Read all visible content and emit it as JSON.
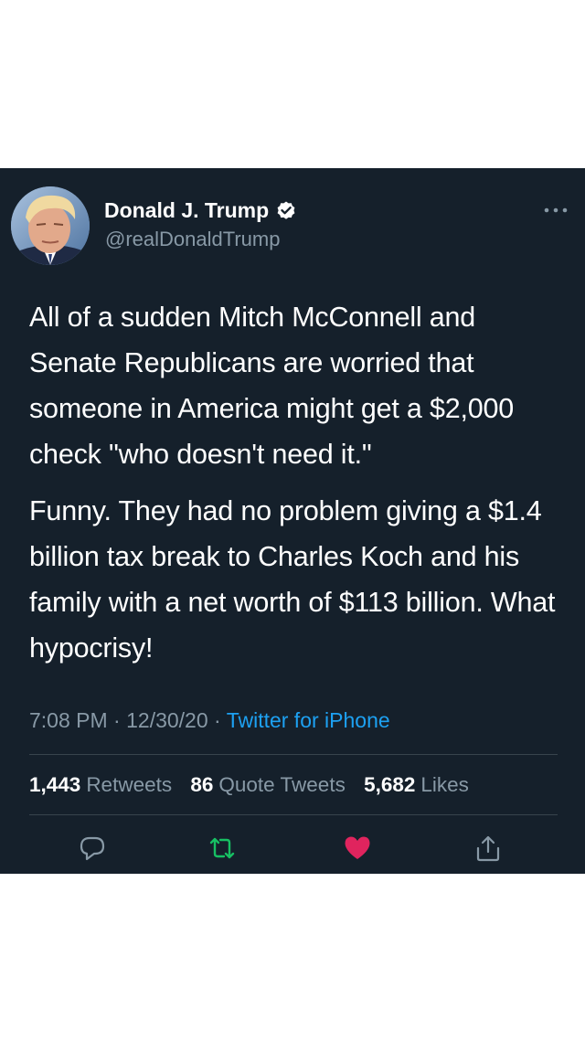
{
  "user": {
    "name": "Donald J. Trump",
    "handle": "@realDonaldTrump",
    "verified": true
  },
  "tweet": {
    "paragraphs": [
      "All of a sudden Mitch McConnell and Senate Republicans are worried that someone in America might get a $2,000 check \"who doesn't need it.\"",
      "Funny. They had no problem giving a $1.4 billion tax break to Charles Koch and his family with a net worth of $113 billion. What hypocrisy!"
    ],
    "time": "7:08 PM",
    "date": "12/30/20",
    "separator": "·",
    "source": "Twitter for iPhone"
  },
  "stats": {
    "retweets": {
      "count": "1,443",
      "label": "Retweets"
    },
    "quote_tweets": {
      "count": "86",
      "label": "Quote Tweets"
    },
    "likes": {
      "count": "5,682",
      "label": "Likes"
    }
  },
  "actions": {
    "reply_icon": "reply-icon",
    "retweet_icon": "retweet-icon",
    "like_icon": "heart-icon",
    "share_icon": "share-icon",
    "liked": true
  },
  "colors": {
    "background": "#15202b",
    "text": "#ffffff",
    "secondary_text": "#8899a6",
    "link": "#1da1f2",
    "retweet": "#17bf63",
    "like": "#e0245e",
    "divider": "#38444d"
  }
}
